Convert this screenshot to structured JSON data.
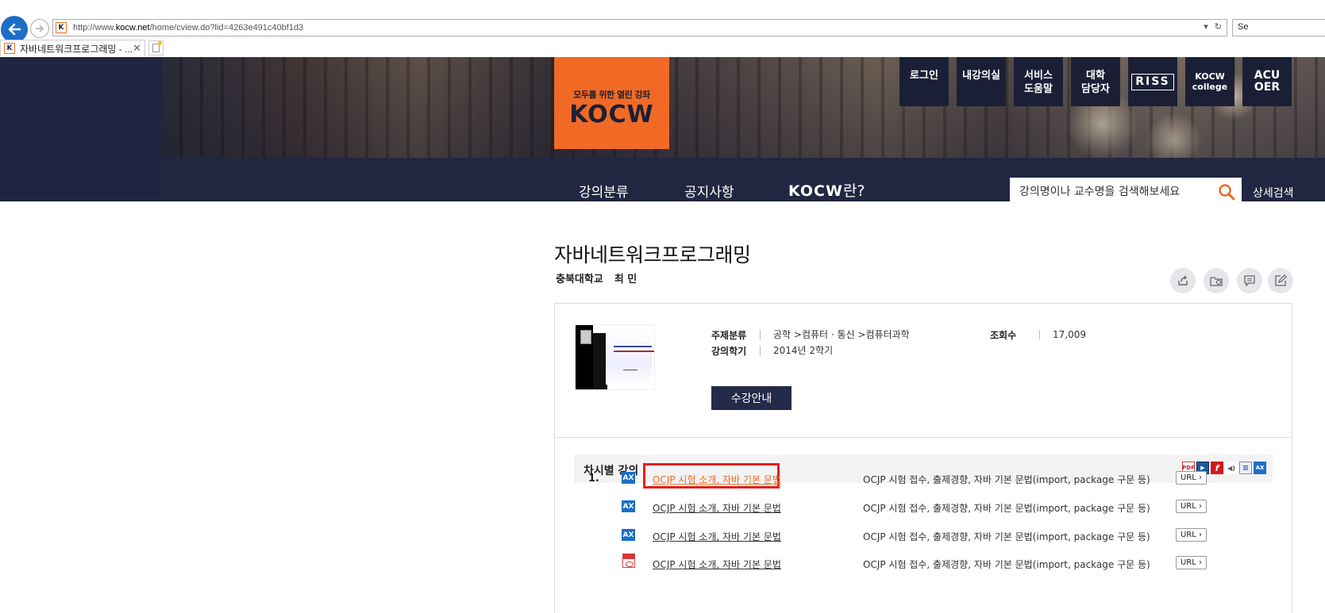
{
  "browser": {
    "url_prefix": "http://www.",
    "url_domain": "kocw.net",
    "url_path": "/home/cview.do?lid=4263e491c40bf1d3",
    "search_stub": "Se",
    "tab_title": "자바네트워크프로그래밍 - ...",
    "favicon_letter": "K"
  },
  "header": {
    "logo_tagline": "모두를 위한 열린 강좌",
    "logo_word": "KOCW",
    "top_buttons": [
      {
        "label": "로그인"
      },
      {
        "label": "내강의실"
      },
      {
        "label": "서비스\n도움말"
      },
      {
        "label": "대학\n담당자"
      },
      {
        "label": "RISS"
      },
      {
        "label": "KOCW\ncollege"
      },
      {
        "label": "ACU\nOER"
      }
    ],
    "nav": {
      "category": "강의분류",
      "notice": "공지사항",
      "about_brand": "KOCW",
      "about_suffix": "란?"
    },
    "search_placeholder": "강의명이나 교수명을 검색해보세요",
    "advanced_search": "상세검색"
  },
  "course": {
    "title": "자바네트워크프로그래밍",
    "university": "충북대학교",
    "professor": "최 민",
    "subject_label": "주제분류",
    "subject_value": "공학 >컴퓨터 · 통신 >컴퓨터과학",
    "semester_label": "강의학기",
    "semester_value": "2014년 2학기",
    "views_label": "조회수",
    "views_value": "17,009",
    "enroll_button": "수강안내"
  },
  "lectures": {
    "header": "차시별 강의",
    "legend": [
      "PDF",
      "▶",
      "f",
      "◀)",
      "≡",
      "AX"
    ],
    "rows": [
      {
        "num": "1.",
        "type": "AX",
        "title": "OCJP 시험 소개, 자바 기본 문법",
        "desc": "OCJP 시험 접수, 출제경향, 자바 기본 문법(import, package 구문 등)",
        "url": "URL ›"
      },
      {
        "num": "",
        "type": "AX",
        "title": "OCJP 시험 소개, 자바 기본 문법",
        "desc": "OCJP 시험 접수, 출제경향, 자바 기본 문법(import, package 구문 등)",
        "url": "URL ›"
      },
      {
        "num": "",
        "type": "AX",
        "title": "OCJP 시험 소개, 자바 기본 문법",
        "desc": "OCJP 시험 접수, 출제경향, 자바 기본 문법(import, package 구문 등)",
        "url": "URL ›"
      },
      {
        "num": "",
        "type": "PDF",
        "title": "OCJP 시험 소개, 자바 기본 문법",
        "desc": "OCJP 시험 접수, 출제경향, 자바 기본 문법(import, package 구문 등)",
        "url": "URL ›"
      }
    ]
  },
  "colors": {
    "brand_orange": "#f06a25",
    "navy": "#1b1f36",
    "highlight_red": "#e0201f",
    "ax_blue": "#1a6fc7"
  }
}
